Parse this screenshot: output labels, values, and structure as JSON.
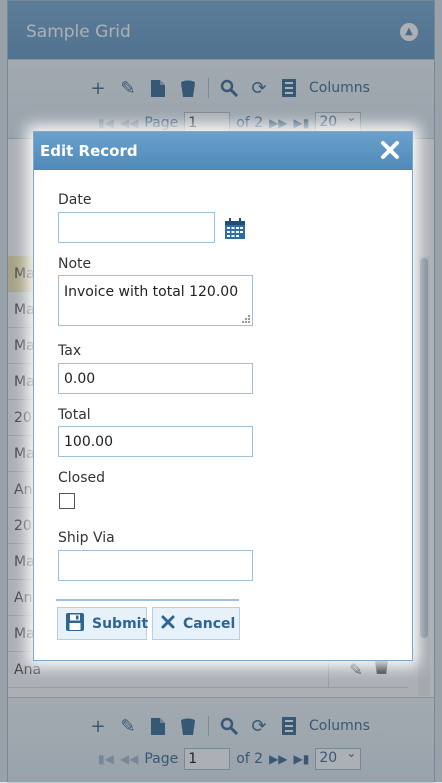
{
  "grid": {
    "title": "Sample Grid",
    "toolbar": {
      "columns_label": "Columns",
      "page_label": "Page",
      "page_value": "1",
      "of_label": "of 2",
      "page_size": "20"
    },
    "rows": [
      {
        "text": "Ma",
        "selected": true
      },
      {
        "text": "Ma",
        "selected": false
      },
      {
        "text": "Ma",
        "selected": false
      },
      {
        "text": "Ma",
        "selected": false
      },
      {
        "text": "20",
        "selected": false
      },
      {
        "text": "Ma",
        "selected": false
      },
      {
        "text": "An",
        "selected": false
      },
      {
        "text": "20",
        "selected": false
      },
      {
        "text": "Ma",
        "selected": false
      },
      {
        "text": "An",
        "selected": false
      },
      {
        "text": "Ma",
        "selected": false
      },
      {
        "text": "Ana",
        "selected": false
      }
    ]
  },
  "dialog": {
    "title": "Edit Record",
    "fields": {
      "date_label": "Date",
      "date_value": "",
      "note_label": "Note",
      "note_value": "Invoice with total 120.00",
      "tax_label": "Tax",
      "tax_value": "0.00",
      "total_label": "Total",
      "total_value": "100.00",
      "closed_label": "Closed",
      "closed_checked": false,
      "shipvia_label": "Ship Via",
      "shipvia_value": ""
    },
    "buttons": {
      "submit_label": "Submit",
      "cancel_label": "Cancel"
    }
  },
  "colors": {
    "header": "#5a8fbc",
    "accent": "#2e6592",
    "selected_row": "#f4e7a7"
  }
}
